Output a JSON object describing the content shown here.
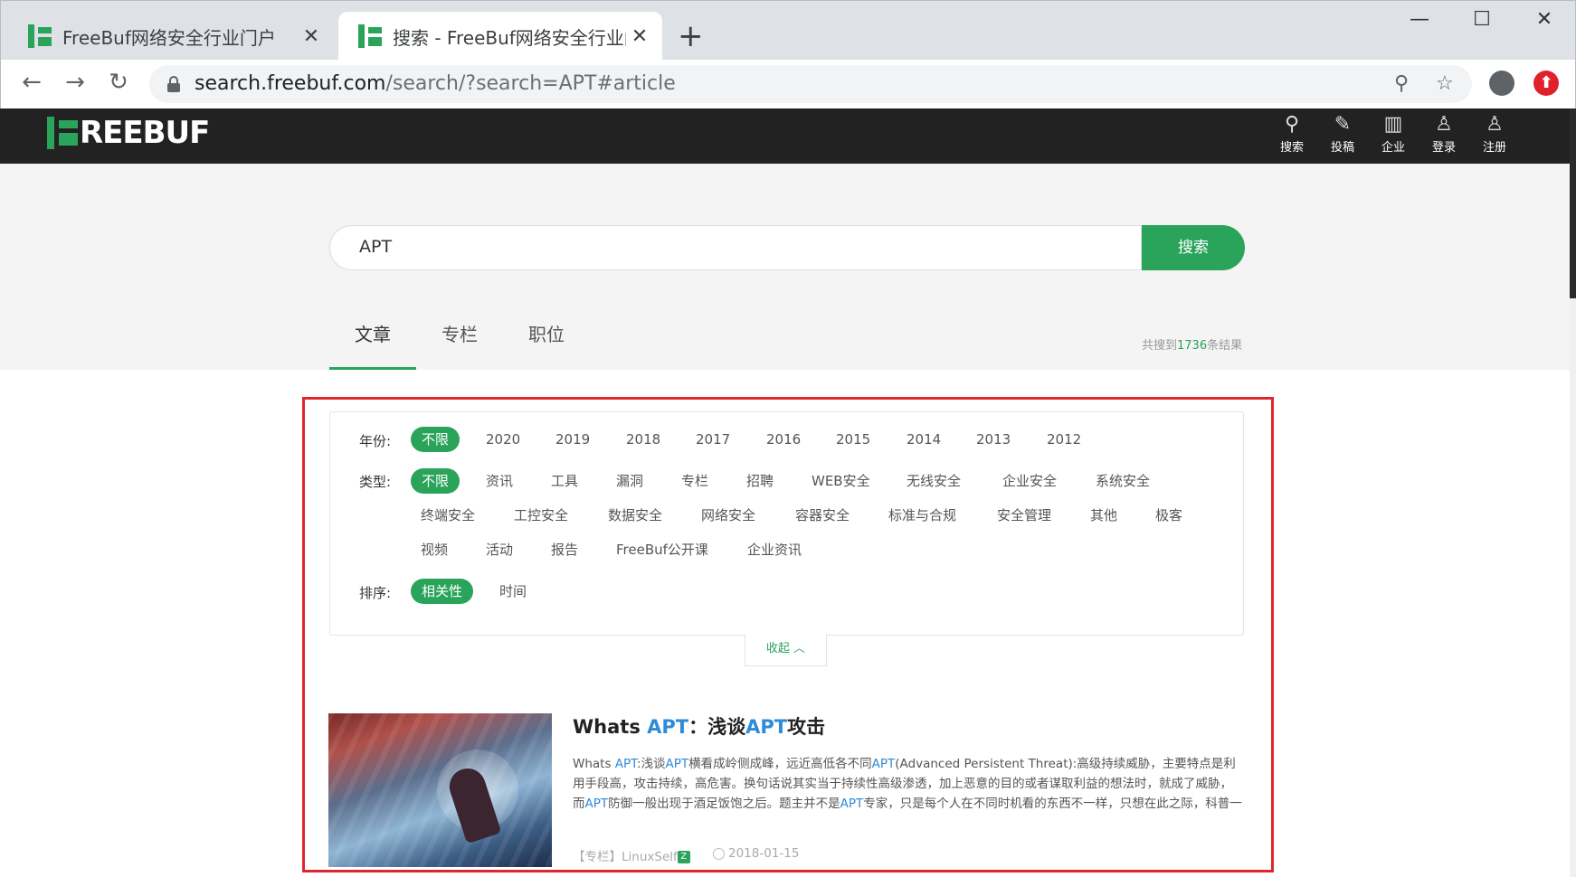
{
  "browser": {
    "tabs": [
      {
        "title": "FreeBuf网络安全行业门户",
        "active": false
      },
      {
        "title": "搜索 - FreeBuf网络安全行业门户",
        "active": true
      }
    ],
    "new_tab": "+",
    "url_domain": "search.freebuf.com",
    "url_rest": "/search/?search=APT#article",
    "controls": {
      "minimize": "—",
      "maximize": "☐",
      "close": "✕"
    },
    "nav": {
      "back": "←",
      "forward": "→",
      "reload": "↻"
    },
    "icons": {
      "zoom": "⚲",
      "star": "☆"
    }
  },
  "site": {
    "logo_text": "REEBUF",
    "header_items": [
      {
        "label": "搜索",
        "icon": "search-icon",
        "glyph": "⚲"
      },
      {
        "label": "投稿",
        "icon": "edit-icon",
        "glyph": "✎"
      },
      {
        "label": "企业",
        "icon": "building-icon",
        "glyph": "▥"
      },
      {
        "label": "登录",
        "icon": "user-icon",
        "glyph": "♙"
      },
      {
        "label": "注册",
        "icon": "user-plus-icon",
        "glyph": "♙"
      }
    ]
  },
  "search": {
    "value": "APT",
    "button": "搜索",
    "tabs": [
      "文章",
      "专栏",
      "职位"
    ],
    "count_prefix": "共搜到",
    "count": "1736",
    "count_suffix": "条结果"
  },
  "filters": {
    "year_label": "年份:",
    "years": [
      "不限",
      "2020",
      "2019",
      "2018",
      "2017",
      "2016",
      "2015",
      "2014",
      "2013",
      "2012"
    ],
    "type_label": "类型:",
    "types_row1": [
      "不限",
      "资讯",
      "工具",
      "漏洞",
      "专栏",
      "招聘",
      "WEB安全",
      "无线安全",
      "企业安全",
      "系统安全"
    ],
    "types_row2": [
      "终端安全",
      "工控安全",
      "数据安全",
      "网络安全",
      "容器安全",
      "标准与合规",
      "安全管理",
      "其他",
      "极客"
    ],
    "types_row3": [
      "视频",
      "活动",
      "报告",
      "FreeBuf公开课",
      "企业资讯"
    ],
    "sort_label": "排序:",
    "sorts": [
      "相关性",
      "时间"
    ],
    "collapse": "收起 ︿"
  },
  "article": {
    "title_parts": [
      "Whats ",
      "APT",
      "：浅谈",
      "APT",
      "攻击"
    ],
    "body_parts": [
      "Whats ",
      "APT",
      ":浅谈",
      "APT",
      "横看成岭侧成峰，远近高低各不同",
      "APT",
      "(Advanced Persistent Threat):高级持续威胁，主要特点是利用手段高，攻击持续，高危害。换句话说其实当于持续性高级渗透，加上恶意的目的或者谋取利益的想法时，就成了威胁，而",
      "APT",
      "防御一般出现于酒足饭饱之后。题主并不是",
      "APT",
      "专家，只是每个人在不同时机看的东西不一样，只想在此之际，科普一"
    ],
    "meta_source": "【专栏】LinuxSelf",
    "meta_badge": "Z",
    "date": "2018-01-15"
  }
}
